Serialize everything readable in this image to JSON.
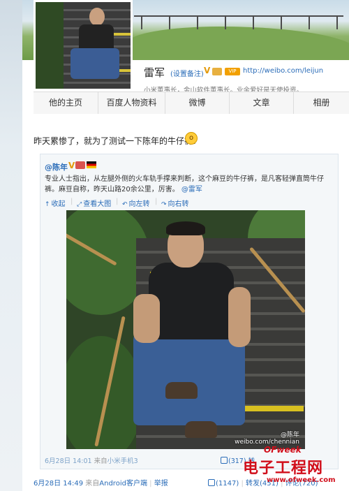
{
  "profile": {
    "name": "雷军",
    "remark_link": "(设置备注)",
    "verified_badge": "V",
    "vip_badge": "VIP",
    "homepage_url": "http://weibo.com/leijun",
    "bio": "小米董事长，金山软件董事长。业余爱好是天使投资。"
  },
  "tabs": [
    {
      "label": "他的主页"
    },
    {
      "label": "百度人物资料"
    },
    {
      "label": "微博"
    },
    {
      "label": "文章"
    },
    {
      "label": "相册"
    }
  ],
  "post": {
    "text": "昨天累惨了，就为了测试一下陈年的牛仔裤？",
    "repost": {
      "author": "@陈年",
      "verified_badge": "V",
      "body_part1": "专业人士指出，从左腿外侧的火车轨手撑来判断，这个麻豆的牛仔裤，是凡客轻弹直筒牛仔裤。麻豆自称，昨天山路20余公里，厉害。",
      "body_mention": "@雷军",
      "actions": [
        "收起",
        "查看大图",
        "向左转",
        "向右转"
      ],
      "photo_watermark_handle": "@陈年",
      "photo_watermark_url": "weibo.com/chennian",
      "date": "6月28日 14:01",
      "from_label": "来自",
      "source": "小米手机3",
      "likes": "(317)",
      "forward": "转"
    },
    "date": "6月28日 14:49",
    "from_label": "来自",
    "source": "Android客户端",
    "report": "举报",
    "likes": "(1147)",
    "forward": "转发(451)",
    "comments": "评论(720)"
  },
  "watermark": {
    "brand": "OFweek",
    "title": "电子工程网",
    "url": "www.ofweek.com"
  },
  "colors": {
    "link": "#2a6cb8",
    "verified": "#e39a0c",
    "watermark": "#d10f1b"
  }
}
